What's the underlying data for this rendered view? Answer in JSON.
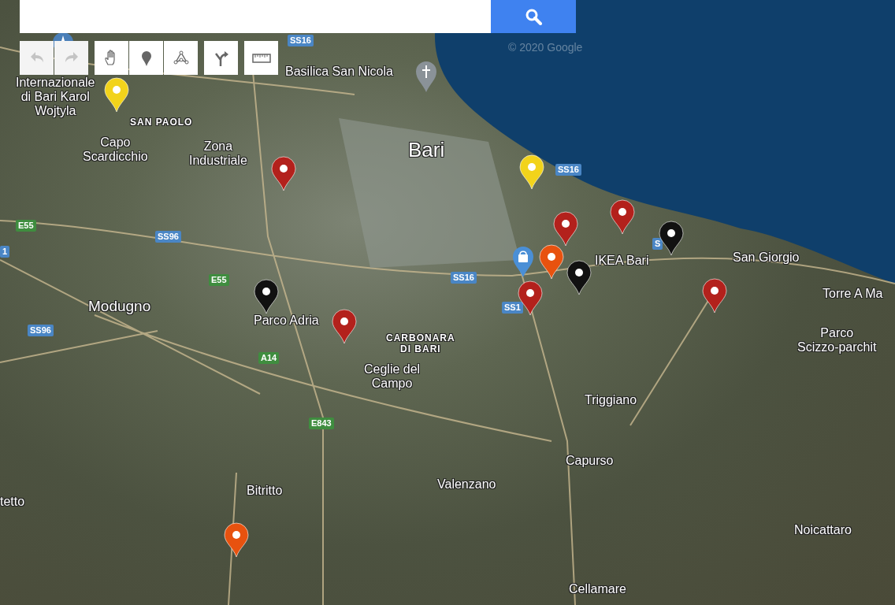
{
  "toolbar": [
    {
      "kind": "undo",
      "disabled": true
    },
    {
      "kind": "redo",
      "disabled": true
    },
    {
      "kind": "hand",
      "disabled": false
    },
    {
      "kind": "marker",
      "disabled": false
    },
    {
      "kind": "line",
      "disabled": false
    },
    {
      "kind": "directions",
      "disabled": false
    },
    {
      "kind": "ruler",
      "disabled": false
    }
  ],
  "map": {
    "attribution": "© 2020 Google",
    "labels": [
      {
        "text": "Internazionale\ndi Bari Karol\nWojtyla",
        "kind": "place"
      },
      {
        "text": "Basilica San Nicola",
        "kind": "place"
      },
      {
        "text": "SAN PAOLO",
        "kind": "district"
      },
      {
        "text": "Capo\nScardicchio",
        "kind": "place"
      },
      {
        "text": "Zona\nIndustriale",
        "kind": "place"
      },
      {
        "text": "Bari",
        "kind": "city"
      },
      {
        "text": "IKEA Bari",
        "kind": "place"
      },
      {
        "text": "San Giorgio",
        "kind": "place"
      },
      {
        "text": "Torre A Ma",
        "kind": "place"
      },
      {
        "text": "Parco\nScizzo-parchit",
        "kind": "place"
      },
      {
        "text": "Modugno",
        "kind": "town"
      },
      {
        "text": "Parco Adria",
        "kind": "place"
      },
      {
        "text": "CARBONARA\nDI BARI",
        "kind": "district"
      },
      {
        "text": "Ceglie del\nCampo",
        "kind": "place"
      },
      {
        "text": "Triggiano",
        "kind": "place"
      },
      {
        "text": "Capurso",
        "kind": "place"
      },
      {
        "text": "Valenzano",
        "kind": "place"
      },
      {
        "text": "Bitritto",
        "kind": "place"
      },
      {
        "text": "tetto",
        "kind": "place"
      },
      {
        "text": "Noicattaro",
        "kind": "place"
      },
      {
        "text": "Cellamare",
        "kind": "place"
      }
    ],
    "road_shields": [
      {
        "text": "SS16"
      },
      {
        "text": "SS16"
      },
      {
        "text": "E55"
      },
      {
        "text": "SS96"
      },
      {
        "text": "E55"
      },
      {
        "text": "SS16"
      },
      {
        "text": "SS1"
      },
      {
        "text": "S"
      },
      {
        "text": "1"
      },
      {
        "text": "SS96"
      },
      {
        "text": "A14"
      },
      {
        "text": "E843"
      }
    ],
    "poi": [
      {
        "kind": "airport"
      },
      {
        "kind": "church"
      },
      {
        "kind": "shop"
      }
    ],
    "pins": [
      {
        "color": "#f2d31b"
      },
      {
        "color": "#f2d31b"
      },
      {
        "color": "#b3211c"
      },
      {
        "color": "#b3211c"
      },
      {
        "color": "#e8520f"
      },
      {
        "color": "#b3211c"
      },
      {
        "color": "#111111"
      },
      {
        "color": "#111111"
      },
      {
        "color": "#b3211c"
      },
      {
        "color": "#b3211c"
      },
      {
        "color": "#111111"
      },
      {
        "color": "#b3211c"
      },
      {
        "color": "#e8520f"
      }
    ]
  }
}
